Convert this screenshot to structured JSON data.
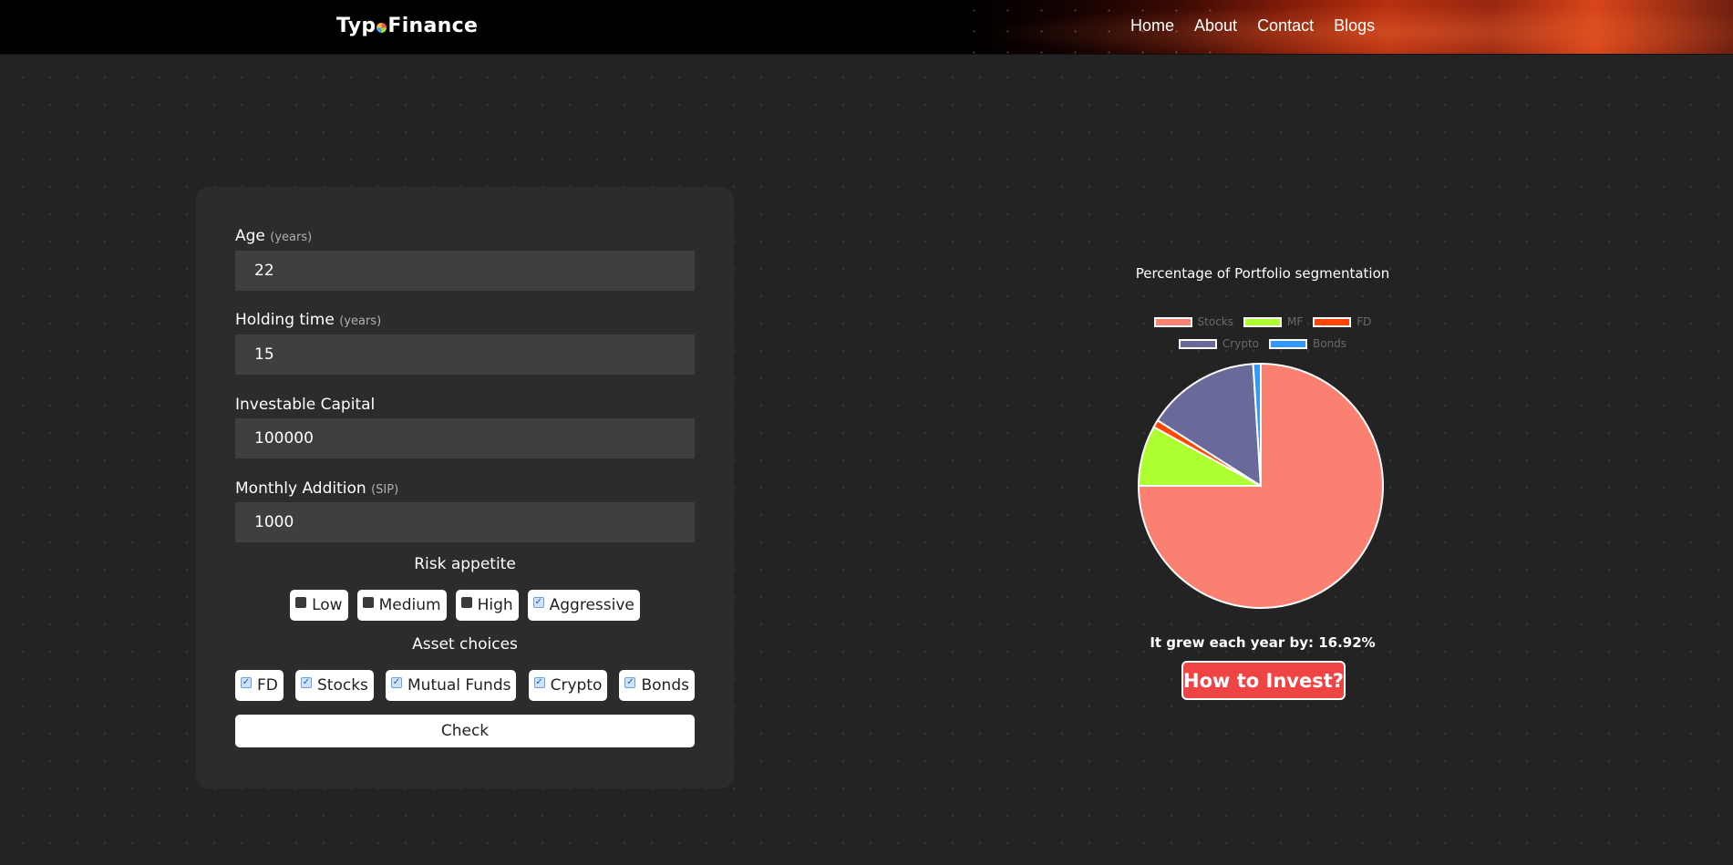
{
  "brand": {
    "name_part1": "Typ",
    "name_part2": "Finance"
  },
  "nav": [
    "Home",
    "About",
    "Contact",
    "Blogs"
  ],
  "form": {
    "age": {
      "label": "Age",
      "unit": "(years)",
      "value": "22"
    },
    "holding_time": {
      "label": "Holding time",
      "unit": "(years)",
      "value": "15"
    },
    "capital": {
      "label": "Investable Capital",
      "value": "100000"
    },
    "monthly": {
      "label": "Monthly Addition",
      "unit": "(SIP)",
      "value": "1000"
    },
    "risk": {
      "title": "Risk appetite",
      "options": [
        {
          "label": "Low",
          "checked": false
        },
        {
          "label": "Medium",
          "checked": false
        },
        {
          "label": "High",
          "checked": false
        },
        {
          "label": "Aggressive",
          "checked": true
        }
      ]
    },
    "assets": {
      "title": "Asset choices",
      "options": [
        {
          "label": "FD",
          "checked": true
        },
        {
          "label": "Stocks",
          "checked": true
        },
        {
          "label": "Mutual Funds",
          "checked": true
        },
        {
          "label": "Crypto",
          "checked": true
        },
        {
          "label": "Bonds",
          "checked": true
        }
      ]
    },
    "check_label": "Check"
  },
  "chart_data": {
    "type": "pie",
    "title": "Percentage of Portfolio segmentation",
    "categories": [
      "Stocks",
      "MF",
      "FD",
      "Crypto",
      "Bonds"
    ],
    "values": [
      75,
      8,
      1,
      15,
      1
    ],
    "colors": [
      "#fa8072",
      "#adff2f",
      "#ff4500",
      "#6a6a9a",
      "#3399ff"
    ],
    "legend_position": "top"
  },
  "result": {
    "growth_text": "It grew each year by: 16.92%"
  },
  "invest_label": "How to Invest?"
}
